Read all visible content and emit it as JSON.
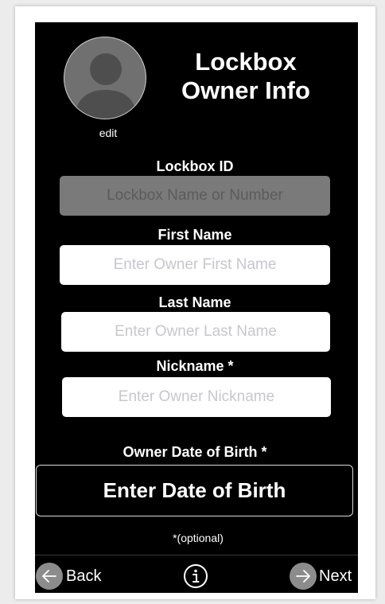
{
  "header": {
    "title_line1": "Lockbox",
    "title_line2": "Owner Info",
    "avatar_icon": "person-silhouette-icon",
    "edit_label": "edit"
  },
  "form": {
    "lockbox_id": {
      "label": "Lockbox ID",
      "placeholder": "Lockbox Name or Number",
      "value": ""
    },
    "first_name": {
      "label": "First Name",
      "placeholder": "Enter Owner First Name",
      "value": ""
    },
    "last_name": {
      "label": "Last Name",
      "placeholder": "Enter Owner Last Name",
      "value": ""
    },
    "nickname": {
      "label": "Nickname *",
      "placeholder": "Enter Owner Nickname",
      "value": ""
    },
    "dob": {
      "label": "Owner Date of Birth *",
      "button_label": "Enter Date of Birth"
    },
    "optional_note": "*(optional)"
  },
  "nav": {
    "back_label": "Back",
    "next_label": "Next",
    "back_icon": "left-arrow-circle-icon",
    "next_icon": "right-arrow-circle-icon",
    "info_icon": "info-circle-icon"
  },
  "colors": {
    "screen_bg": "#000000",
    "disabled_field": "#7a7a7a",
    "avatar_gray": "#707070",
    "nav_circle": "#8c8c8c"
  }
}
